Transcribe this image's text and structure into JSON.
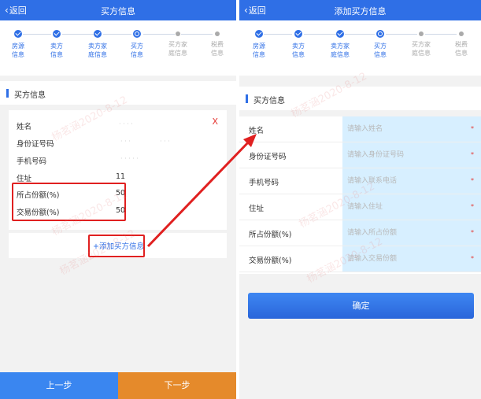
{
  "left": {
    "back_label": "返回",
    "title": "买方信息",
    "steps": [
      {
        "label": "房源\n信息",
        "state": "done"
      },
      {
        "label": "卖方\n信息",
        "state": "done"
      },
      {
        "label": "卖方家\n庭信息",
        "state": "done"
      },
      {
        "label": "买方\n信息",
        "state": "current"
      },
      {
        "label": "买方家\n庭信息",
        "state": "todo"
      },
      {
        "label": "税费\n信息",
        "state": "todo"
      }
    ],
    "section_title": "买方信息",
    "card": {
      "close_label": "X",
      "rows": [
        {
          "label": "姓名",
          "value": ""
        },
        {
          "label": "身份证号码",
          "value": ""
        },
        {
          "label": "手机号码",
          "value": ""
        },
        {
          "label": "住址",
          "value": "11"
        },
        {
          "label": "所占份额(%)",
          "value": "50"
        },
        {
          "label": "交易份额(%)",
          "value": "50"
        }
      ]
    },
    "add_label": "+添加买方信息",
    "prev_label": "上一步",
    "next_label": "下一步"
  },
  "right": {
    "back_label": "返回",
    "title": "添加买方信息",
    "section_title": "买方信息",
    "fields": [
      {
        "label": "姓名",
        "placeholder": "请输入姓名"
      },
      {
        "label": "身份证号码",
        "placeholder": "请输入身份证号码"
      },
      {
        "label": "手机号码",
        "placeholder": "请输入联系电话"
      },
      {
        "label": "住址",
        "placeholder": "请输入住址"
      },
      {
        "label": "所占份额(%)",
        "placeholder": "请输入所占份额"
      },
      {
        "label": "交易份额(%)",
        "placeholder": "请输入交易份额"
      }
    ],
    "required_mark": "*",
    "confirm_label": "确定"
  },
  "watermark_text": "杨茗涵2020-8-12",
  "colors": {
    "primary": "#2f6fe6",
    "next_button": "#e58a2b",
    "annotation_red": "#e02020",
    "input_bg": "#d7efff"
  }
}
